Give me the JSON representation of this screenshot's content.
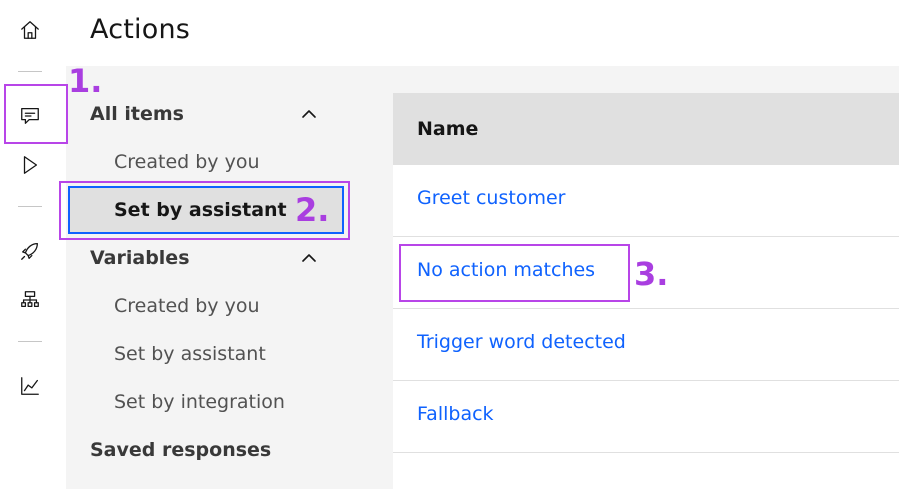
{
  "page": {
    "title": "Actions"
  },
  "rail": {
    "icons": [
      "home-icon",
      "chat-icon",
      "play-icon",
      "rocket-icon",
      "tree-icon",
      "analytics-icon"
    ]
  },
  "sidebar": {
    "sections": [
      {
        "label": "All items",
        "expanded": true,
        "items": [
          "Created by you",
          "Set by assistant"
        ]
      },
      {
        "label": "Variables",
        "expanded": true,
        "items": [
          "Created by you",
          "Set by assistant",
          "Set by integration"
        ]
      },
      {
        "label": "Saved responses",
        "expanded": false,
        "items": []
      }
    ],
    "selected": "Set by assistant"
  },
  "table": {
    "header": "Name",
    "rows": [
      "Greet customer",
      "No action matches",
      "Trigger word detected",
      "Fallback"
    ]
  },
  "annotations": [
    "1.",
    "2.",
    "3."
  ],
  "colors": {
    "accent": "#0f62fe",
    "annotation": "#b845e8",
    "gray_bg": "#f4f4f4",
    "header_bg": "#e0e0e0"
  }
}
